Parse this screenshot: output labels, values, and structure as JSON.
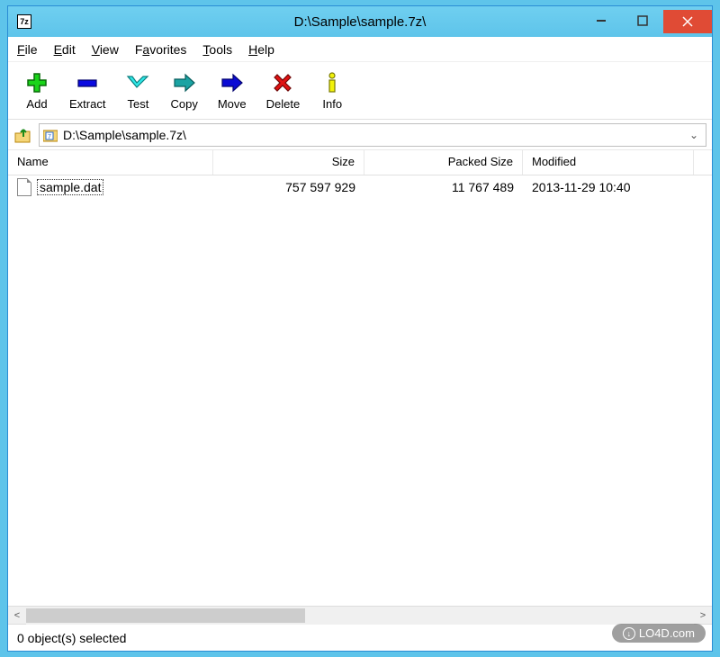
{
  "window": {
    "title": "D:\\Sample\\sample.7z\\"
  },
  "menu": {
    "file": "File",
    "edit": "Edit",
    "view": "View",
    "favorites": "Favorites",
    "tools": "Tools",
    "help": "Help"
  },
  "toolbar": {
    "add": "Add",
    "extract": "Extract",
    "test": "Test",
    "copy": "Copy",
    "move": "Move",
    "delete": "Delete",
    "info": "Info"
  },
  "address": {
    "path": "D:\\Sample\\sample.7z\\"
  },
  "columns": {
    "name": "Name",
    "size": "Size",
    "packed": "Packed Size",
    "modified": "Modified"
  },
  "files": [
    {
      "name": "sample.dat",
      "size": "757 597 929",
      "packed": "11 767 489",
      "modified": "2013-11-29 10:40"
    }
  ],
  "status": {
    "text": "0 object(s) selected"
  },
  "watermark": "LO4D.com"
}
